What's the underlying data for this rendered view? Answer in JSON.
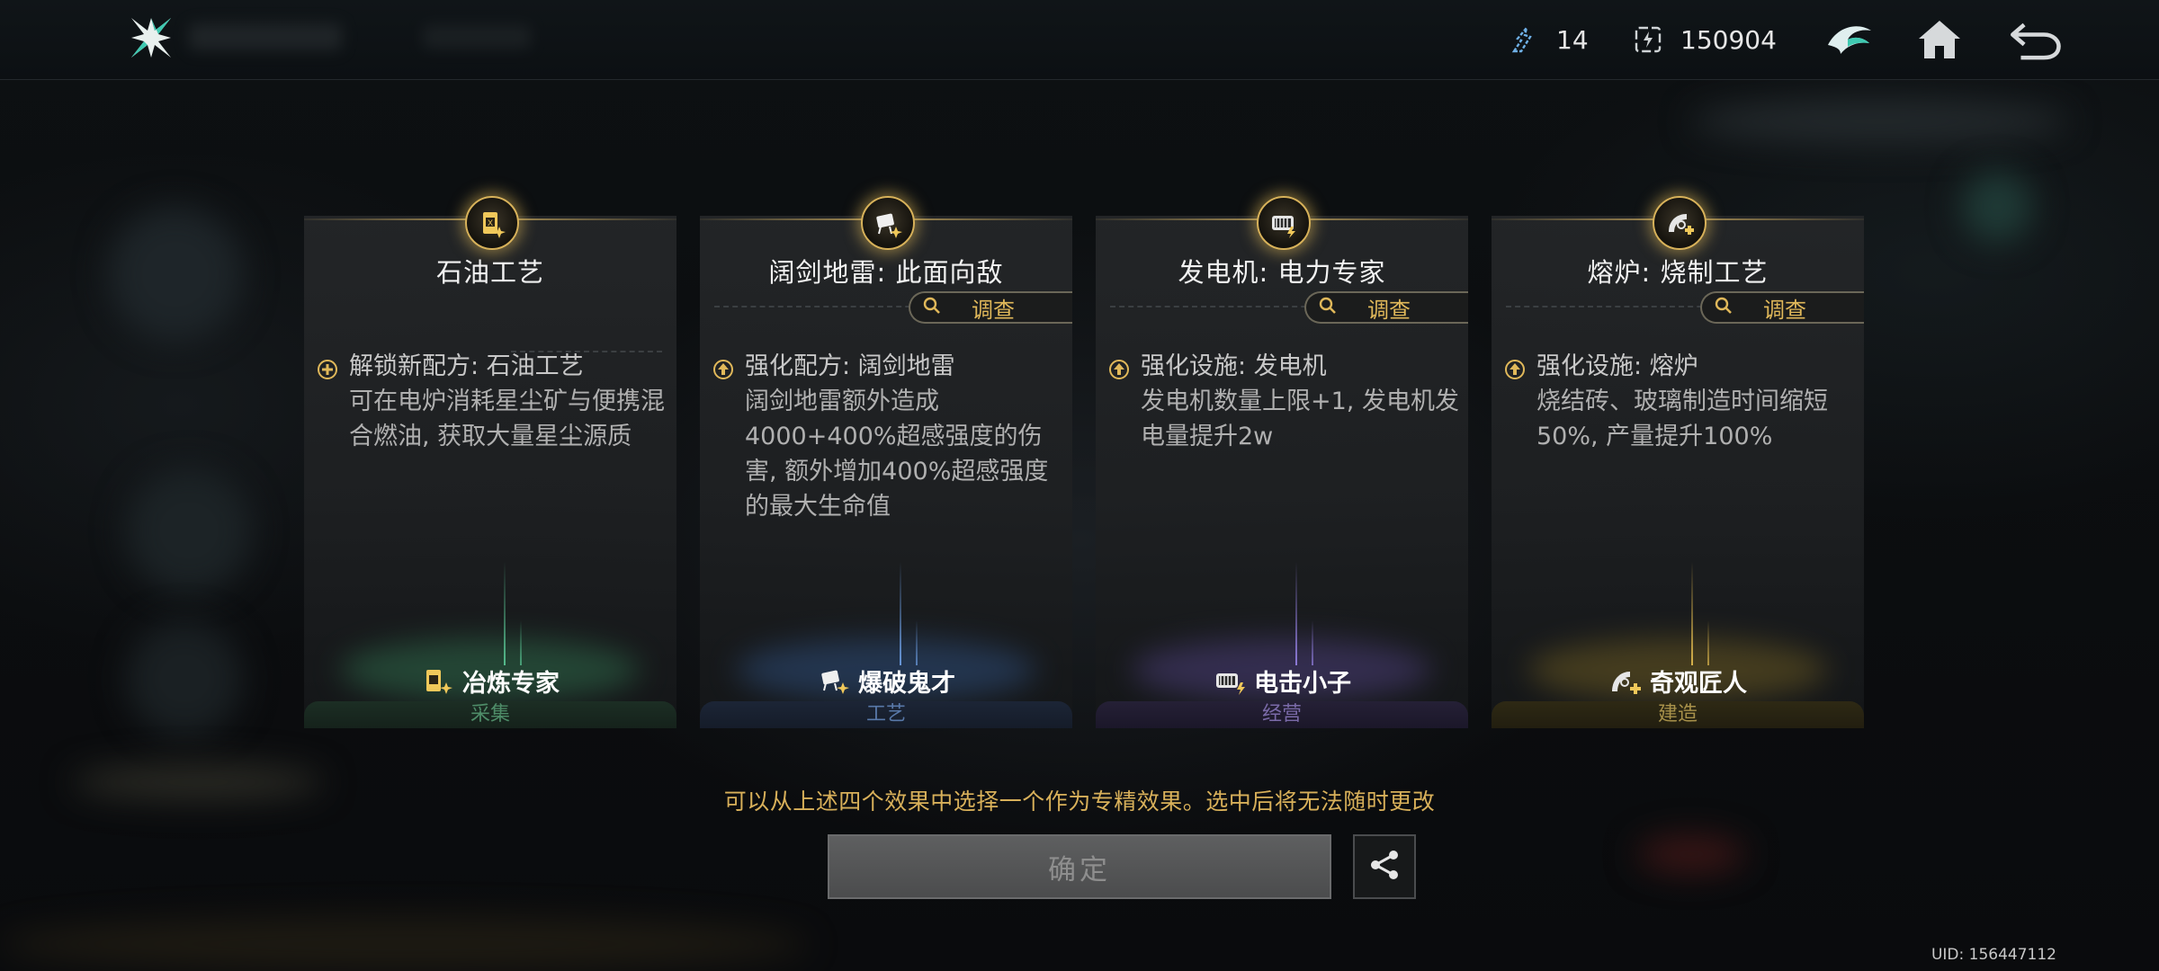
{
  "topbar": {
    "resource_1_value": "14",
    "resource_2_value": "150904",
    "icons": [
      "app-logo-icon",
      "crystal-icon",
      "energy-icon",
      "leader-icon",
      "home-icon",
      "back-icon"
    ]
  },
  "cards": [
    {
      "title": "石油工艺",
      "has_inspect": false,
      "inspect_label": "",
      "effect_line": "解锁新配方: 石油工艺",
      "desc": "可在电炉消耗星尘矿与便携混合燃油, 获取大量星尘源质",
      "effect_icon": "plus-circle-icon",
      "specialist": "冶炼专家",
      "category": "采集",
      "accent": "#2f6b4b"
    },
    {
      "title": "阔剑地雷: 此面向敌",
      "has_inspect": true,
      "inspect_label": "调查",
      "effect_line": "强化配方: 阔剑地雷",
      "desc": "阔剑地雷额外造成4000+400%超感强度的伤害, 额外增加400%超感强度的最大生命值",
      "effect_icon": "upgrade-arrow-icon",
      "specialist": "爆破鬼才",
      "category": "工艺",
      "accent": "#2e4d7a"
    },
    {
      "title": "发电机: 电力专家",
      "has_inspect": true,
      "inspect_label": "调查",
      "effect_line": "强化设施: 发电机",
      "desc": "发电机数量上限+1, 发电机发电量提升2w",
      "effect_icon": "upgrade-arrow-icon",
      "specialist": "电击小子",
      "category": "经营",
      "accent": "#4c3f7a"
    },
    {
      "title": "熔炉: 烧制工艺",
      "has_inspect": true,
      "inspect_label": "调查",
      "effect_line": "强化设施: 熔炉",
      "desc": "烧结砖、玻璃制造时间缩短50%, 产量提升100%",
      "effect_icon": "upgrade-arrow-icon",
      "specialist": "奇观匠人",
      "category": "建造",
      "accent": "#6b5a22"
    }
  ],
  "hint": "可以从上述四个效果中选择一个作为专精效果。选中后将无法随时更改",
  "confirm_label": "确定",
  "uid": "UID: 156447112"
}
